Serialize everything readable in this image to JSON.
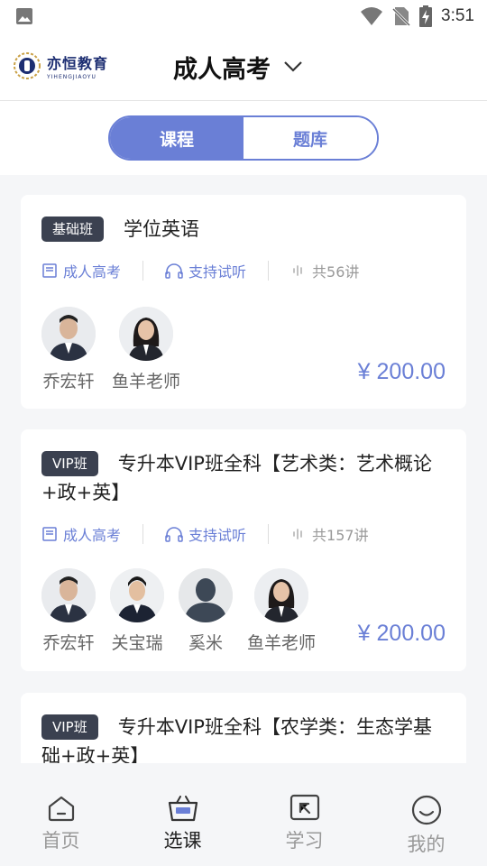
{
  "status_bar": {
    "time": "3:51",
    "icons": [
      "image-icon",
      "wifi-icon",
      "no-sim-icon",
      "battery-charging-icon"
    ]
  },
  "header": {
    "logo_cn": "亦恒教育",
    "logo_en": "YIHENGJIAOYU",
    "title": "成人高考",
    "dropdown_icon": "chevron-down-icon"
  },
  "tabs": [
    {
      "label": "课程",
      "active": true
    },
    {
      "label": "题库",
      "active": false
    }
  ],
  "courses": [
    {
      "badge": "基础班",
      "title": "学位英语",
      "category": "成人高考",
      "trial": "支持试听",
      "lessons": "共56讲",
      "teachers": [
        "乔宏轩",
        "鱼羊老师"
      ],
      "price": "¥ 200.00"
    },
    {
      "badge": "VIP班",
      "title": "专升本VIP班全科【艺术类：艺术概论+政+英】",
      "category": "成人高考",
      "trial": "支持试听",
      "lessons": "共157讲",
      "teachers": [
        "乔宏轩",
        "关宝瑞",
        "奚米",
        "鱼羊老师"
      ],
      "price": "¥ 200.00"
    },
    {
      "badge": "VIP班",
      "title": "专升本VIP班全科【农学类：生态学基础+政+英】"
    }
  ],
  "bottom_nav": [
    {
      "label": "首页",
      "icon": "home-icon",
      "active": false
    },
    {
      "label": "选课",
      "icon": "basket-icon",
      "active": true
    },
    {
      "label": "学习",
      "icon": "study-icon",
      "active": false
    },
    {
      "label": "我的",
      "icon": "smile-icon",
      "active": false
    }
  ],
  "colors": {
    "accent": "#6a7fd6",
    "badge_bg": "#3b4150",
    "page_bg": "#f5f6f8"
  }
}
